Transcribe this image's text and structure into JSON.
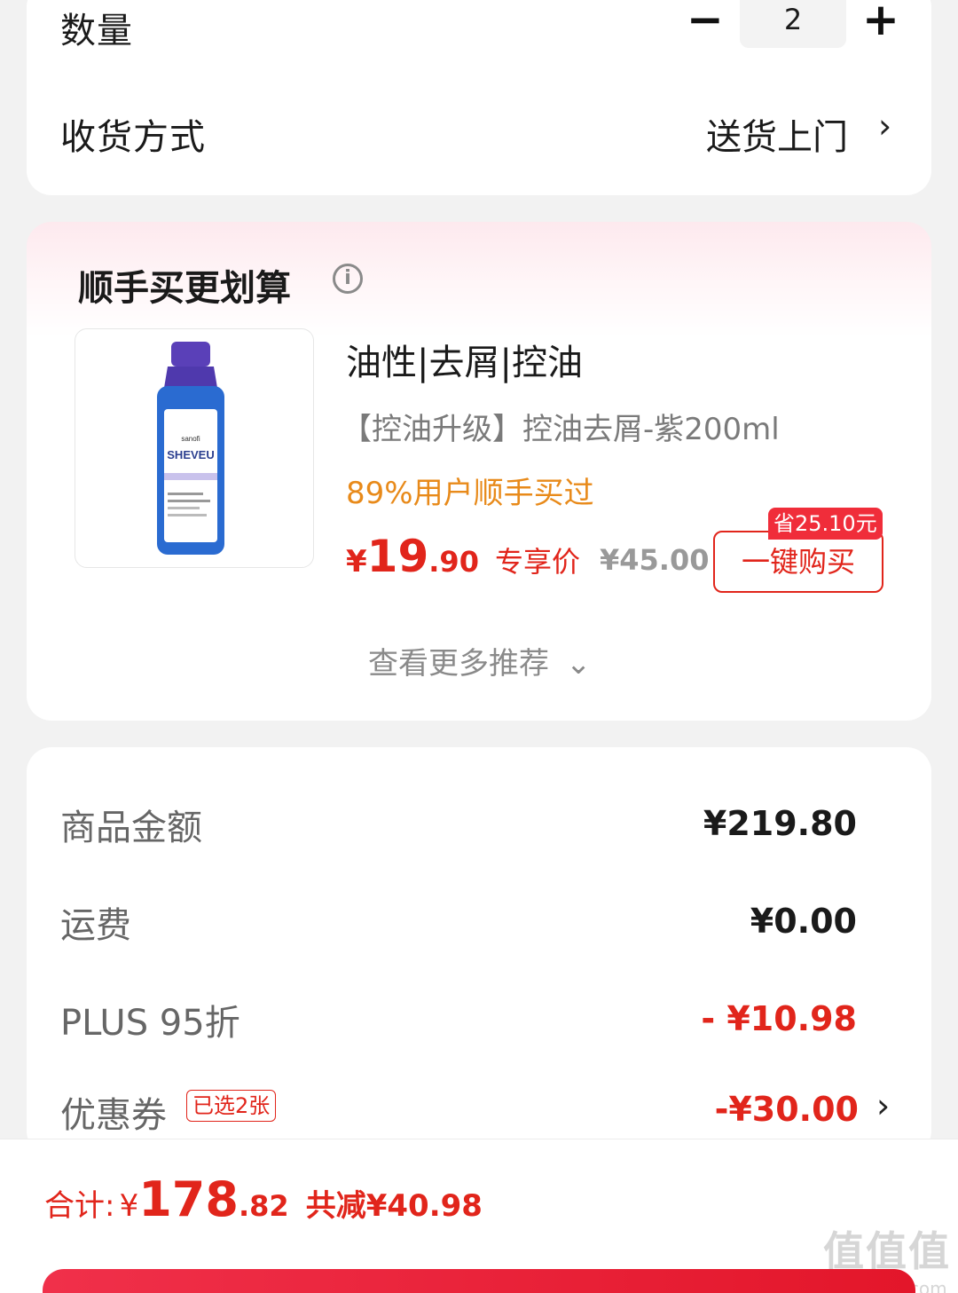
{
  "quantity": {
    "label": "数量",
    "minus": "−",
    "value": "2",
    "plus": "+"
  },
  "delivery": {
    "label": "收货方式",
    "value": "送货上门",
    "chevron": "›"
  },
  "recommend": {
    "title": "顺手买更划算",
    "info_icon": "i",
    "product": {
      "name": "油性|去屑|控油",
      "spec": "【控油升级】控油去屑-紫200ml",
      "tag": "89%用户顺手买过",
      "price_currency": "¥",
      "price_int": "19",
      "price_dec": ".90",
      "price_label": "专享价",
      "original_price": "¥45.00",
      "save_badge": "省25.10元",
      "buy_label": "一键购买",
      "image_brand": "SHEVEU",
      "image_maker": "sanofi"
    },
    "more_label": "查看更多推荐",
    "more_icon": "⌄"
  },
  "fees": {
    "goods_label": "商品金额",
    "goods_value": "¥219.80",
    "shipping_label": "运费",
    "shipping_value": "¥0.00",
    "plus_label": "PLUS 95折",
    "plus_value": "- ¥10.98",
    "coupon_label": "优惠券",
    "coupon_badge": "已选2张",
    "coupon_value": "-¥30.00",
    "coupon_chevron": "›"
  },
  "total": {
    "label": "合计:",
    "currency": "¥",
    "int": "178",
    "dec": ".82",
    "saved": "共减¥40.98"
  },
  "watermark": {
    "big": "值值值",
    "small": "zhizhizhi.com"
  },
  "colors": {
    "accent": "#e1251b",
    "tag": "#e88a1a",
    "badge": "#f02d3a"
  }
}
